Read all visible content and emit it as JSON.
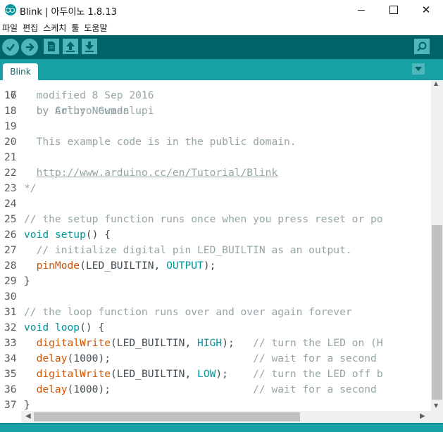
{
  "window": {
    "title": "Blink | 아두이노 1.8.13",
    "close_glyph": "✕"
  },
  "menu": [
    "파일",
    "편집",
    "스케치",
    "툴",
    "도움말"
  ],
  "tabs": [
    {
      "label": "Blink"
    }
  ],
  "colors": {
    "toolbar": "#006468",
    "tabbar": "#17a1a5",
    "button": "#4db7bb",
    "keyword": "#00979c",
    "function": "#d35400",
    "comment": "#95a5a6"
  },
  "editor": {
    "partial_top_line": {
      "number": "16",
      "text": "  by Arturo Guadalupi"
    },
    "lines": [
      {
        "number": "17",
        "parts": [
          {
            "t": "  modified 8 Sep 2016",
            "c": "cm"
          }
        ]
      },
      {
        "number": "18",
        "parts": [
          {
            "t": "  by Colby Newman",
            "c": "cm"
          }
        ]
      },
      {
        "number": "19",
        "parts": []
      },
      {
        "number": "20",
        "parts": [
          {
            "t": "  This example code is in the public domain.",
            "c": "cm"
          }
        ]
      },
      {
        "number": "21",
        "parts": []
      },
      {
        "number": "22",
        "parts": [
          {
            "t": "  ",
            "c": "cm"
          },
          {
            "t": "http://www.arduino.cc/en/Tutorial/Blink",
            "c": "url"
          }
        ]
      },
      {
        "number": "23",
        "parts": [
          {
            "t": "*/",
            "c": "cm"
          }
        ]
      },
      {
        "number": "24",
        "parts": []
      },
      {
        "number": "25",
        "parts": [
          {
            "t": "// the setup function runs once when you press reset or po",
            "c": "cm"
          }
        ]
      },
      {
        "number": "26",
        "parts": [
          {
            "t": "void",
            "c": "kw"
          },
          {
            "t": " ",
            "c": "txt"
          },
          {
            "t": "setup",
            "c": "kw"
          },
          {
            "t": "() {",
            "c": "txt"
          }
        ]
      },
      {
        "number": "27",
        "parts": [
          {
            "t": "  // initialize digital pin LED_BUILTIN as an output.",
            "c": "cm"
          }
        ]
      },
      {
        "number": "28",
        "parts": [
          {
            "t": "  ",
            "c": "txt"
          },
          {
            "t": "pinMode",
            "c": "fn"
          },
          {
            "t": "(LED_BUILTIN, ",
            "c": "txt"
          },
          {
            "t": "OUTPUT",
            "c": "kw"
          },
          {
            "t": ");",
            "c": "txt"
          }
        ]
      },
      {
        "number": "29",
        "parts": [
          {
            "t": "}",
            "c": "txt"
          }
        ]
      },
      {
        "number": "30",
        "parts": []
      },
      {
        "number": "31",
        "parts": [
          {
            "t": "// the loop function runs over and over again forever",
            "c": "cm"
          }
        ]
      },
      {
        "number": "32",
        "parts": [
          {
            "t": "void",
            "c": "kw"
          },
          {
            "t": " ",
            "c": "txt"
          },
          {
            "t": "loop",
            "c": "kw"
          },
          {
            "t": "() {",
            "c": "txt"
          }
        ]
      },
      {
        "number": "33",
        "parts": [
          {
            "t": "  ",
            "c": "txt"
          },
          {
            "t": "digitalWrite",
            "c": "fn"
          },
          {
            "t": "(LED_BUILTIN, ",
            "c": "txt"
          },
          {
            "t": "HIGH",
            "c": "kw"
          },
          {
            "t": ");   ",
            "c": "txt"
          },
          {
            "t": "// turn the LED on (H",
            "c": "cm"
          }
        ]
      },
      {
        "number": "34",
        "parts": [
          {
            "t": "  ",
            "c": "txt"
          },
          {
            "t": "delay",
            "c": "fn"
          },
          {
            "t": "(1000);                       ",
            "c": "txt"
          },
          {
            "t": "// wait for a second",
            "c": "cm"
          }
        ]
      },
      {
        "number": "35",
        "parts": [
          {
            "t": "  ",
            "c": "txt"
          },
          {
            "t": "digitalWrite",
            "c": "fn"
          },
          {
            "t": "(LED_BUILTIN, ",
            "c": "txt"
          },
          {
            "t": "LOW",
            "c": "kw"
          },
          {
            "t": ");    ",
            "c": "txt"
          },
          {
            "t": "// turn the LED off b",
            "c": "cm"
          }
        ]
      },
      {
        "number": "36",
        "parts": [
          {
            "t": "  ",
            "c": "txt"
          },
          {
            "t": "delay",
            "c": "fn"
          },
          {
            "t": "(1000);                       ",
            "c": "txt"
          },
          {
            "t": "// wait for a second",
            "c": "cm"
          }
        ]
      },
      {
        "number": "37",
        "parts": [
          {
            "t": "}",
            "c": "txt"
          }
        ]
      }
    ]
  }
}
